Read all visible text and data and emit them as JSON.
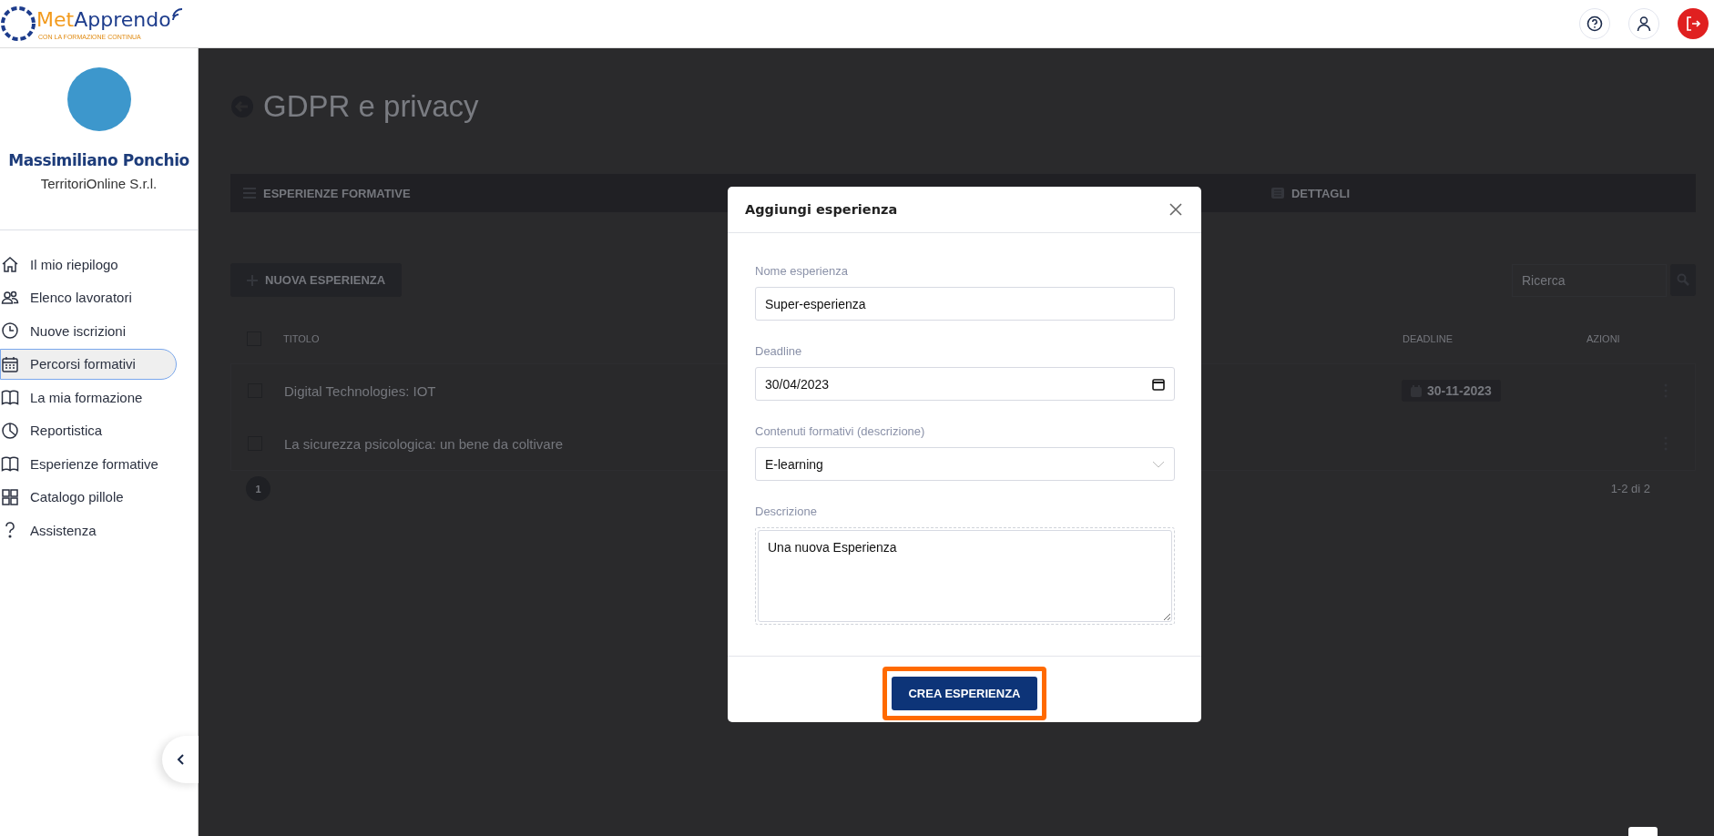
{
  "header": {
    "logo": {
      "text_1": "Met",
      "text_2": "Apprendo",
      "tagline": "CON LA FORMAZIONE CONTINUA"
    }
  },
  "user": {
    "name": "Massimiliano Ponchio",
    "company": "TerritoriOnline S.r.l."
  },
  "sidebar": {
    "items": [
      {
        "kind": "home",
        "label": "Il mio riepilogo",
        "selected": false
      },
      {
        "kind": "users",
        "label": "Elenco lavoratori",
        "selected": false
      },
      {
        "kind": "clock",
        "label": "Nuove iscrizioni",
        "selected": false
      },
      {
        "kind": "calendar",
        "label": "Percorsi formativi",
        "selected": true
      },
      {
        "kind": "book",
        "label": "La mia formazione",
        "selected": false
      },
      {
        "kind": "pie",
        "label": "Reportistica",
        "selected": false
      },
      {
        "kind": "book",
        "label": "Esperienze formative",
        "selected": false
      },
      {
        "kind": "grid",
        "label": "Catalogo pillole",
        "selected": false
      },
      {
        "kind": "question",
        "label": "Assistenza",
        "selected": false
      }
    ]
  },
  "page": {
    "title": "GDPR e privacy",
    "tabs": [
      "ESPERIENZE FORMATIVE",
      "DETTAGLI"
    ],
    "new_button": "NUOVA ESPERIENZA",
    "search": {
      "placeholder": "Ricerca"
    },
    "table": {
      "columns": [
        "TITOLO",
        "DEADLINE",
        "AZIONI"
      ],
      "header_checked": false,
      "rows": [
        {
          "title": "Digital Technologies: IOT",
          "deadline": "30-11-2023",
          "checked": false
        },
        {
          "title": "La sicurezza psicologica: un bene da coltivare",
          "checked": false
        }
      ]
    },
    "pagination": {
      "pages": [
        {
          "label": "1",
          "selected": true
        }
      ],
      "range": "1-2 di 2"
    }
  },
  "dialog": {
    "title": "Aggiungi esperienza",
    "fields": [
      {
        "kind": "text",
        "label": "Nome esperienza",
        "value": "Super-esperienza"
      },
      {
        "kind": "date",
        "label": "Deadline",
        "value": "30/04/2023"
      },
      {
        "kind": "select",
        "label": "Contenuti formativi (descrizione)",
        "value": "E-learning"
      },
      {
        "kind": "textarea",
        "label": "Descrizione",
        "value": "Una nuova Esperienza"
      }
    ],
    "submit": "CREA ESPERIENZA",
    "highlighted": true
  }
}
